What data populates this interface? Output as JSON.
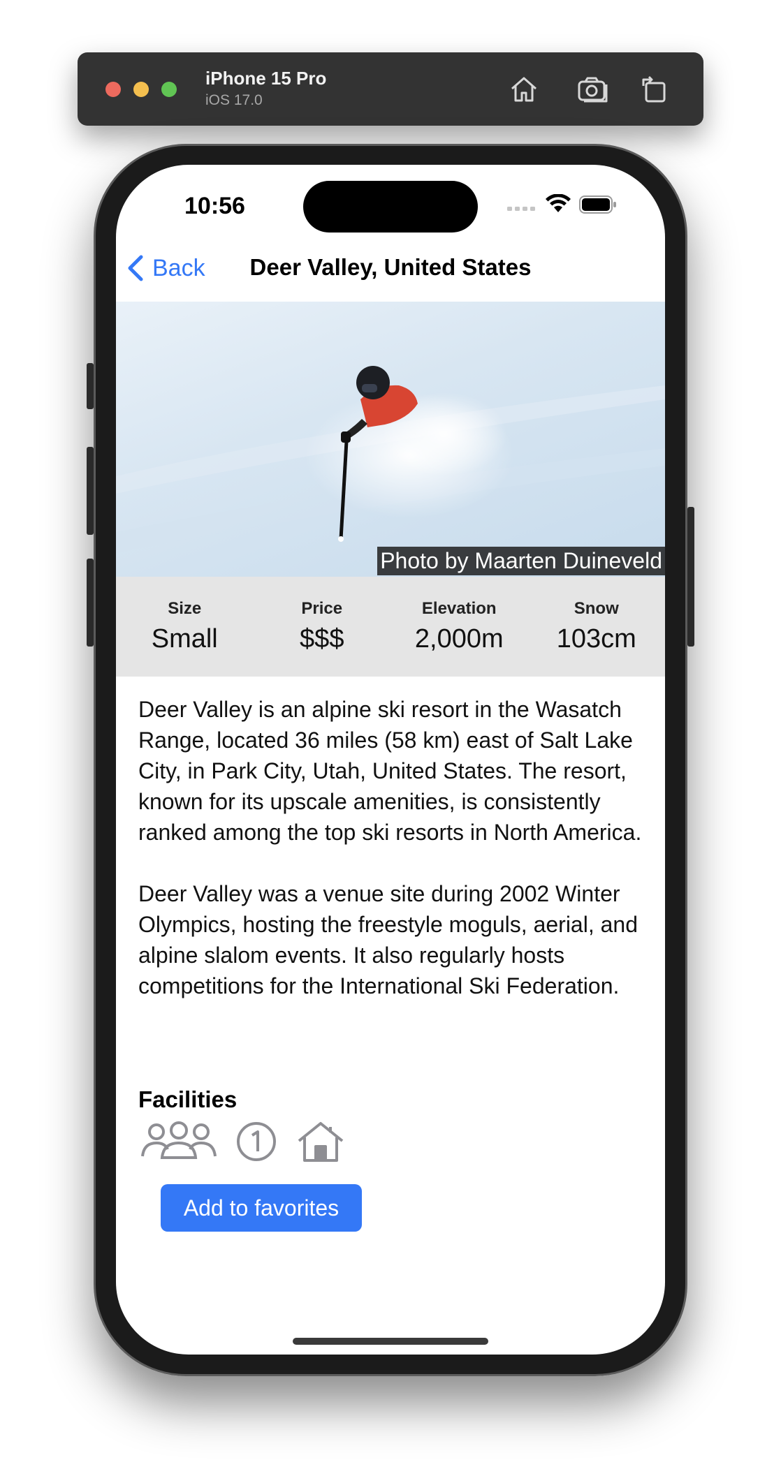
{
  "simulator": {
    "device_name": "iPhone 15 Pro",
    "os_version": "iOS 17.0",
    "buttons": [
      "home-icon",
      "screenshot-icon",
      "rotate-icon"
    ]
  },
  "status_bar": {
    "time": "10:56",
    "icons": [
      "signal-icon",
      "wifi-icon",
      "battery-icon"
    ]
  },
  "nav": {
    "back_label": "Back",
    "title": "Deer Valley, United States"
  },
  "hero": {
    "photo_credit": "Photo by Maarten Duineveld"
  },
  "stats": [
    {
      "label": "Size",
      "value": "Small"
    },
    {
      "label": "Price",
      "value": "$$$"
    },
    {
      "label": "Elevation",
      "value": "2,000m"
    },
    {
      "label": "Snow",
      "value": "103cm"
    }
  ],
  "description": {
    "paragraph_1": "Deer Valley is an alpine ski resort in the Wasatch Range, located 36 miles (58 km) east of Salt Lake City, in Park City, Utah, United States. The resort, known for its upscale amenities, is consistently ranked among the top ski resorts in North America.",
    "paragraph_2": "Deer Valley was a venue site during 2002 Winter Olympics, hosting the freestyle moguls, aerial, and alpine slalom events. It also regularly hosts competitions for the International Ski Federation."
  },
  "facilities": {
    "title": "Facilities",
    "icons": [
      "family-icon",
      "number-one-circle-icon",
      "house-icon"
    ],
    "icon_color": "#8e8e93"
  },
  "actions": {
    "favorite_label": "Add to favorites"
  },
  "colors": {
    "accent": "#3478f6",
    "stats_background": "#e5e5e5"
  }
}
